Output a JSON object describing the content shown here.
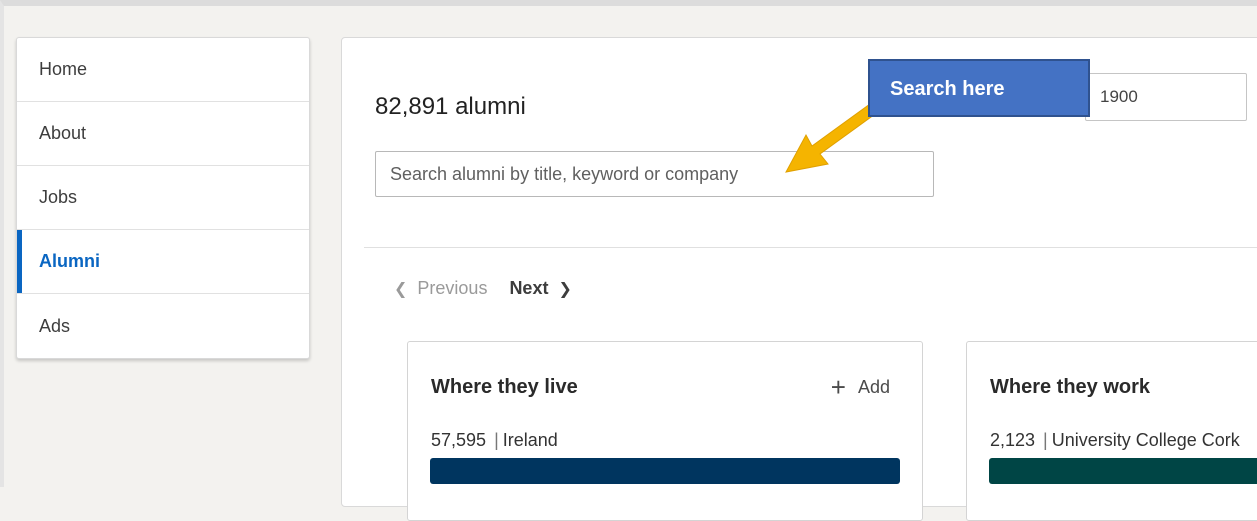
{
  "sidebar": {
    "items": [
      {
        "label": "Home",
        "active": false
      },
      {
        "label": "About",
        "active": false
      },
      {
        "label": "Jobs",
        "active": false
      },
      {
        "label": "Alumni",
        "active": true
      },
      {
        "label": "Ads",
        "active": false
      }
    ]
  },
  "main": {
    "alumni_count": "82,891 alumni",
    "search": {
      "value": "",
      "placeholder": "Search alumni by title, keyword or company"
    },
    "year_field": {
      "value": "1900"
    },
    "callout": {
      "label": "Search here"
    },
    "pager": {
      "previous": "Previous",
      "next": "Next"
    },
    "cards": [
      {
        "title": "Where they live",
        "add_label": "Add",
        "count": "57,595",
        "name": "Ireland",
        "bar_fraction": 1.0,
        "bar_color": "#00355f"
      },
      {
        "title": "Where they work",
        "count": "2,123",
        "name": "University College Cork",
        "bar_fraction": 1.0,
        "bar_color": "#004545"
      }
    ]
  },
  "colors": {
    "accent": "#0a66c2",
    "callout_bg": "#4472c4",
    "arrow": "#f5b400"
  },
  "icons": {
    "previous": "chevron-left-icon",
    "next": "chevron-right-icon",
    "add": "plus-icon",
    "callout_pointer": "arrow-icon"
  }
}
